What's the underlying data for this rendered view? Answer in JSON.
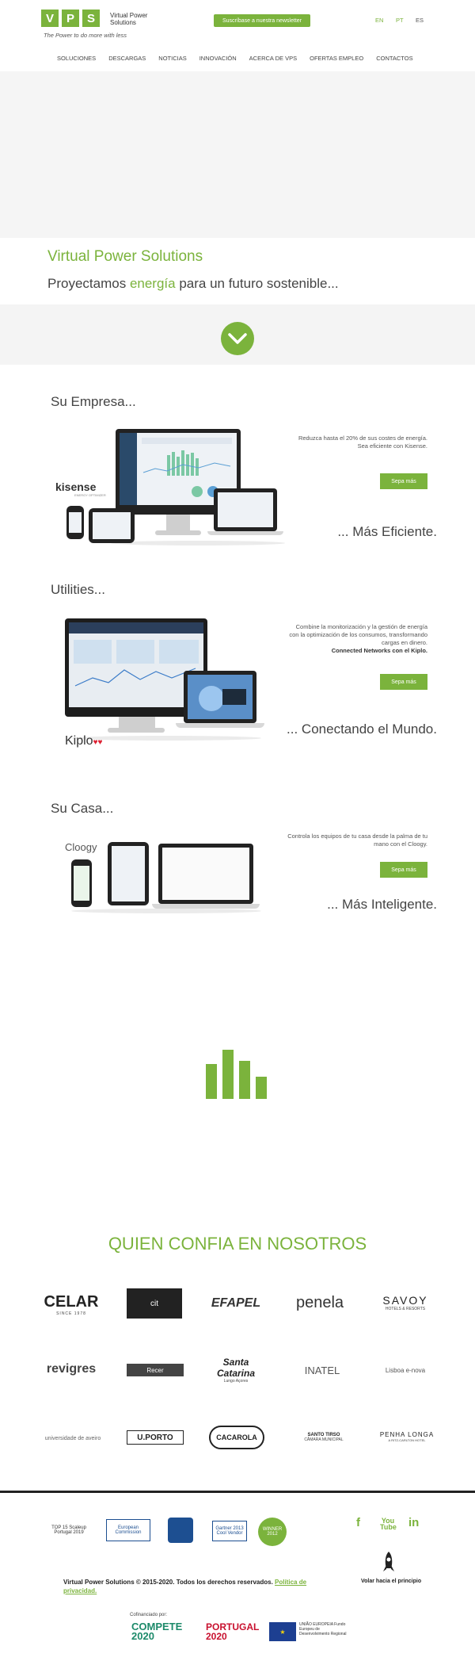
{
  "brand": {
    "letters": [
      "V",
      "P",
      "S"
    ],
    "name": "Virtual Power Solutions",
    "tagline": "The Power to do more with less"
  },
  "header": {
    "newsletter_label": "Suscríbase a nuestra newsletter",
    "langs": [
      "EN",
      "PT",
      "ES"
    ],
    "active_lang": "ES"
  },
  "nav": [
    "SOLUCIONES",
    "DESCARGAS",
    "NOTICIAS",
    "INNOVACIÓN",
    "ACERCA DE VPS",
    "OFERTAS EMPLEO",
    "CONTACTOS"
  ],
  "hero": {
    "title": "Virtual Power Solutions",
    "subtitle_before": "Proyectamos ",
    "subtitle_emph": "energía",
    "subtitle_after": " para un futuro sostenible..."
  },
  "sections": [
    {
      "title": "Su Empresa...",
      "text_1": "Reduzca hasta el 20% de sus costes de energía.",
      "text_2": "Sea eficiente con Kisense.",
      "button": "Sepa más",
      "tag": "... Más Eficiente.",
      "brand": "kisense",
      "brand_sub": "ENERGY OPTIMIZER"
    },
    {
      "title": "Utilities...",
      "text_1": "Combine la monitorización y la gestión de energía con la optimización de los consumos, transformando cargas en dinero.",
      "text_2": "Connected Networks con el Kiplo.",
      "button": "Sepa más",
      "tag": "... Conectando el Mundo.",
      "brand": "Kiplo"
    },
    {
      "title": "Su Casa...",
      "text_1": "Controla los equipos de tu casa desde la palma de tu mano con el Cloogy.",
      "button": "Sepa más",
      "tag": "... Más Inteligente.",
      "brand": "Cloogy"
    }
  ],
  "clients": {
    "title": "QUIEN CONFIA EN NOSOTROS",
    "logos": [
      "CELAR",
      "cit",
      "EFAPEL",
      "penela",
      "SAVOY",
      "revigres",
      "Recer",
      "Santa Catarina",
      "INATEL",
      "Lisboa e-nova",
      "universidade de aveiro",
      "U.PORTO",
      "CACAROLA",
      "SANTO TIRSO",
      "PENHA LONGA"
    ],
    "sublabels": {
      "celar": "SINCE 1978",
      "savoy": "HOTELS & RESORTS",
      "santa": "Lungo Açores",
      "santotirso": "CÂMARA MUNICIPAL",
      "penha": "A RITZ-CARLTON HOTEL"
    }
  },
  "footer": {
    "badges": [
      "TOP 15 Scaleup Portugal 2019",
      "European Commission",
      "Gartner 2013 Cool Vendor",
      "WINNER 2012"
    ],
    "social": [
      "f",
      "You Tube",
      "in"
    ],
    "copyright": "Virtual Power Solutions © 2015-2020. Todos los derechos reservados.",
    "privacy": "Política de privacidad.",
    "back_to_top": "Volar hacia el principio",
    "cofinanced": "Cofinanciado por:",
    "funding": [
      "COMPETE 2020",
      "PORTUGAL 2020",
      "UNIÃO EUROPEIA Fundo Europeu de Desenvolvimento Regional"
    ]
  },
  "colors": {
    "accent": "#7bb33c",
    "dark": "#222222"
  }
}
